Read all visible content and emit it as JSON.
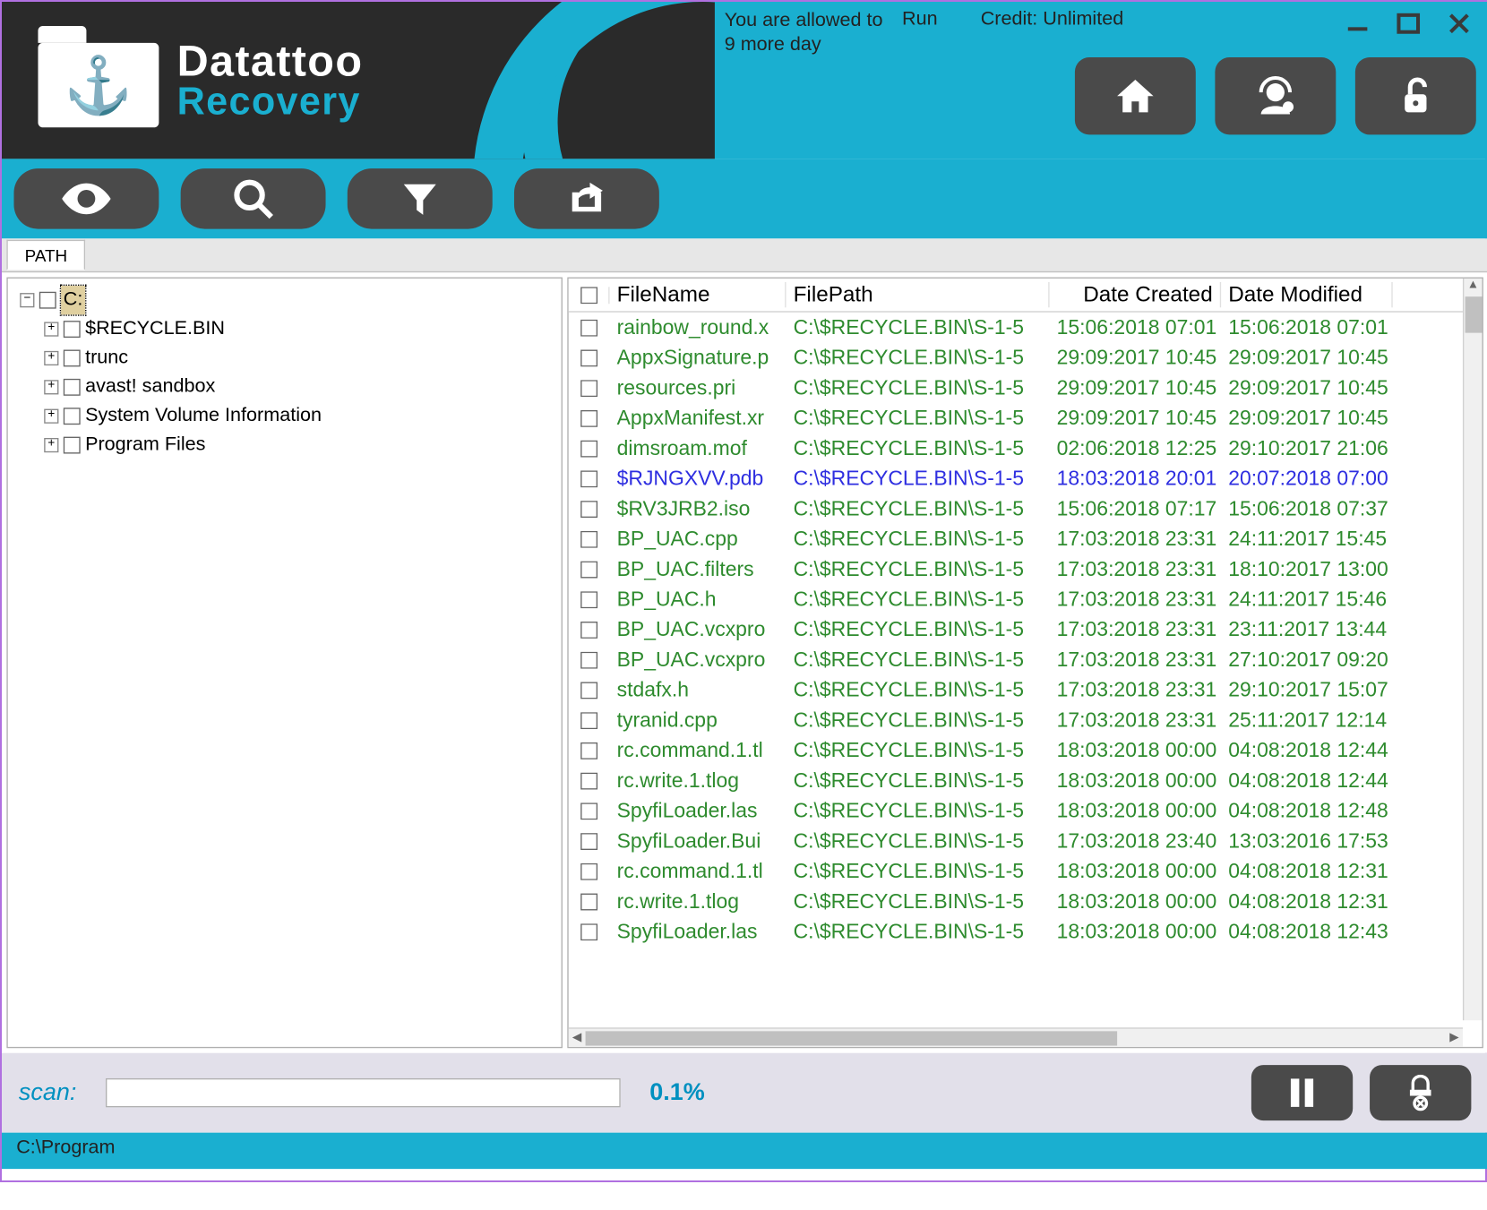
{
  "app": {
    "name": "Datattoo",
    "subname": "Recovery"
  },
  "header": {
    "status_line1": "You are allowed to",
    "status_line2": "9 more day",
    "run_label": "Run",
    "credit_label": "Credit: Unlimited"
  },
  "tab": {
    "label": "PATH"
  },
  "tree": {
    "root": "C:",
    "children": [
      {
        "label": "$RECYCLE.BIN"
      },
      {
        "label": "trunc"
      },
      {
        "label": "avast! sandbox"
      },
      {
        "label": "System Volume Information"
      },
      {
        "label": "Program Files"
      }
    ]
  },
  "columns": {
    "name": "FileName",
    "path": "FilePath",
    "created": "Date Created",
    "modified": "Date Modified"
  },
  "files": [
    {
      "name": "rainbow_round.x",
      "path": "C:\\$RECYCLE.BIN\\S-1-5",
      "created": "15:06:2018 07:01",
      "modified": "15:06:2018 07:01",
      "cls": "green"
    },
    {
      "name": "AppxSignature.p",
      "path": "C:\\$RECYCLE.BIN\\S-1-5",
      "created": "29:09:2017 10:45",
      "modified": "29:09:2017 10:45",
      "cls": "green"
    },
    {
      "name": "resources.pri",
      "path": "C:\\$RECYCLE.BIN\\S-1-5",
      "created": "29:09:2017 10:45",
      "modified": "29:09:2017 10:45",
      "cls": "green"
    },
    {
      "name": "AppxManifest.xr",
      "path": "C:\\$RECYCLE.BIN\\S-1-5",
      "created": "29:09:2017 10:45",
      "modified": "29:09:2017 10:45",
      "cls": "green"
    },
    {
      "name": "dimsroam.mof",
      "path": "C:\\$RECYCLE.BIN\\S-1-5",
      "created": "02:06:2018 12:25",
      "modified": "29:10:2017 21:06",
      "cls": "green"
    },
    {
      "name": "$RJNGXVV.pdb",
      "path": "C:\\$RECYCLE.BIN\\S-1-5",
      "created": "18:03:2018 20:01",
      "modified": "20:07:2018 07:00",
      "cls": "blue"
    },
    {
      "name": "$RV3JRB2.iso",
      "path": "C:\\$RECYCLE.BIN\\S-1-5",
      "created": "15:06:2018 07:17",
      "modified": "15:06:2018 07:37",
      "cls": "green"
    },
    {
      "name": "BP_UAC.cpp",
      "path": "C:\\$RECYCLE.BIN\\S-1-5",
      "created": "17:03:2018 23:31",
      "modified": "24:11:2017 15:45",
      "cls": "green"
    },
    {
      "name": "BP_UAC.filters",
      "path": "C:\\$RECYCLE.BIN\\S-1-5",
      "created": "17:03:2018 23:31",
      "modified": "18:10:2017 13:00",
      "cls": "green"
    },
    {
      "name": "BP_UAC.h",
      "path": "C:\\$RECYCLE.BIN\\S-1-5",
      "created": "17:03:2018 23:31",
      "modified": "24:11:2017 15:46",
      "cls": "green"
    },
    {
      "name": "BP_UAC.vcxpro",
      "path": "C:\\$RECYCLE.BIN\\S-1-5",
      "created": "17:03:2018 23:31",
      "modified": "23:11:2017 13:44",
      "cls": "green"
    },
    {
      "name": "BP_UAC.vcxpro",
      "path": "C:\\$RECYCLE.BIN\\S-1-5",
      "created": "17:03:2018 23:31",
      "modified": "27:10:2017 09:20",
      "cls": "green"
    },
    {
      "name": "stdafx.h",
      "path": "C:\\$RECYCLE.BIN\\S-1-5",
      "created": "17:03:2018 23:31",
      "modified": "29:10:2017 15:07",
      "cls": "green"
    },
    {
      "name": "tyranid.cpp",
      "path": "C:\\$RECYCLE.BIN\\S-1-5",
      "created": "17:03:2018 23:31",
      "modified": "25:11:2017 12:14",
      "cls": "green"
    },
    {
      "name": "rc.command.1.tl",
      "path": "C:\\$RECYCLE.BIN\\S-1-5",
      "created": "18:03:2018 00:00",
      "modified": "04:08:2018 12:44",
      "cls": "green"
    },
    {
      "name": "rc.write.1.tlog",
      "path": "C:\\$RECYCLE.BIN\\S-1-5",
      "created": "18:03:2018 00:00",
      "modified": "04:08:2018 12:44",
      "cls": "green"
    },
    {
      "name": "SpyfiLoader.las",
      "path": "C:\\$RECYCLE.BIN\\S-1-5",
      "created": "18:03:2018 00:00",
      "modified": "04:08:2018 12:48",
      "cls": "green"
    },
    {
      "name": "SpyfiLoader.Bui",
      "path": "C:\\$RECYCLE.BIN\\S-1-5",
      "created": "17:03:2018 23:40",
      "modified": "13:03:2016 17:53",
      "cls": "green"
    },
    {
      "name": "rc.command.1.tl",
      "path": "C:\\$RECYCLE.BIN\\S-1-5",
      "created": "18:03:2018 00:00",
      "modified": "04:08:2018 12:31",
      "cls": "green"
    },
    {
      "name": "rc.write.1.tlog",
      "path": "C:\\$RECYCLE.BIN\\S-1-5",
      "created": "18:03:2018 00:00",
      "modified": "04:08:2018 12:31",
      "cls": "green"
    },
    {
      "name": "SpyfiLoader.las",
      "path": "C:\\$RECYCLE.BIN\\S-1-5",
      "created": "18:03:2018 00:00",
      "modified": "04:08:2018 12:43",
      "cls": "green"
    }
  ],
  "scan": {
    "label": "scan:",
    "percent": "0.1%"
  },
  "status_path": "C:\\Program"
}
